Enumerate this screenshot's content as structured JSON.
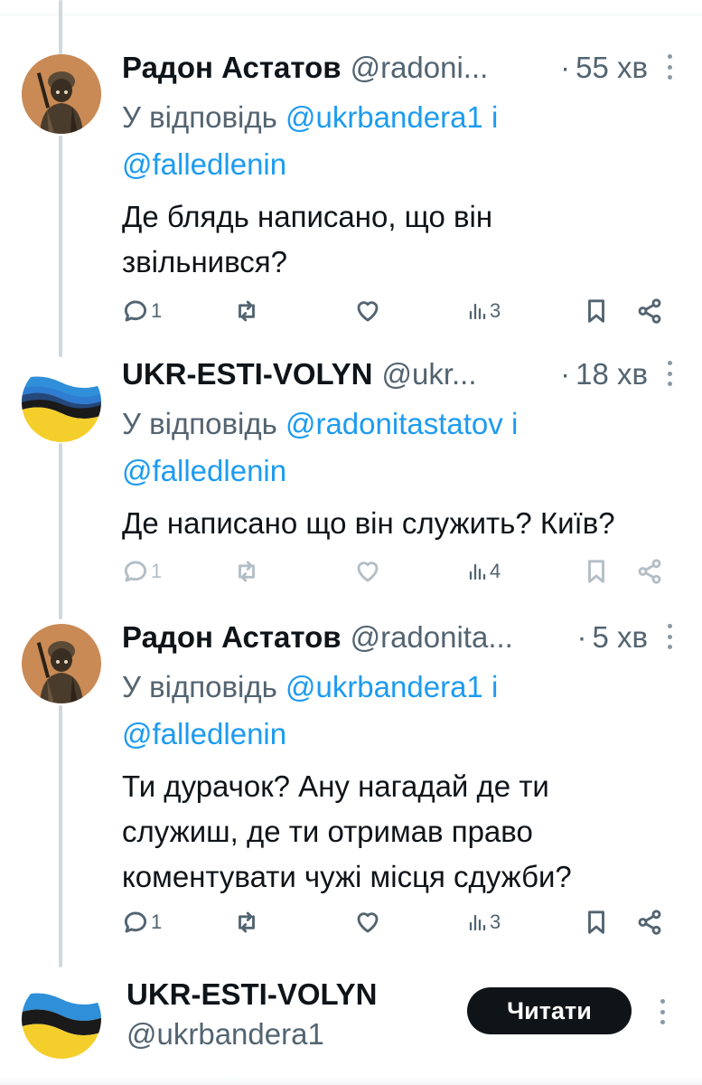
{
  "tweets": [
    {
      "name": "Радон Астатов",
      "handle": "@radoni...",
      "separator": "·",
      "time": "55 хв",
      "reply_prefix": "У відповідь",
      "reply_mention_1": "@ukrbandera1",
      "reply_and": "і",
      "reply_mention_2": "@falledlenin",
      "text_line_1": "Де блядь написано, що він",
      "text_line_2": "звільнився?",
      "text_line_3": "",
      "replies": "1",
      "views": "3",
      "avatar": "soldier"
    },
    {
      "name": "UKR-ESTI-VOLYN",
      "handle": "@ukr...",
      "separator": "·",
      "time": "18 хв",
      "reply_prefix": "У відповідь",
      "reply_mention_1": "@radonitastatov",
      "reply_and": "і",
      "reply_mention_2": "@falledlenin",
      "text_line_1": "Де написано що він служить? Київ?",
      "text_line_2": "",
      "text_line_3": "",
      "replies": "1",
      "views": "4",
      "avatar": "flag"
    },
    {
      "name": "Радон Астатов",
      "handle": "@radonita...",
      "separator": "·",
      "time": "5 хв",
      "reply_prefix": "У відповідь",
      "reply_mention_1": "@ukrbandera1",
      "reply_and": "і",
      "reply_mention_2": "@falledlenin",
      "text_line_1": "Ти дурачок? Ану нагадай де ти",
      "text_line_2": "служиш, де ти отримав право",
      "text_line_3": "коментувати чужі місця сдужби?",
      "replies": "1",
      "views": "3",
      "avatar": "soldier"
    }
  ],
  "follow_card": {
    "name": "UKR-ESTI-VOLYN",
    "handle": "@ukrbandera1",
    "button_label": "Читати"
  },
  "colors": {
    "text": "#0f1419",
    "secondary": "#536471",
    "link": "#1d9bf0",
    "thread_line": "#cfd9de",
    "button_bg": "#0f1419"
  },
  "icons": [
    "reply-icon",
    "retweet-icon",
    "like-icon",
    "views-icon",
    "bookmark-icon",
    "share-icon",
    "more-icon"
  ]
}
